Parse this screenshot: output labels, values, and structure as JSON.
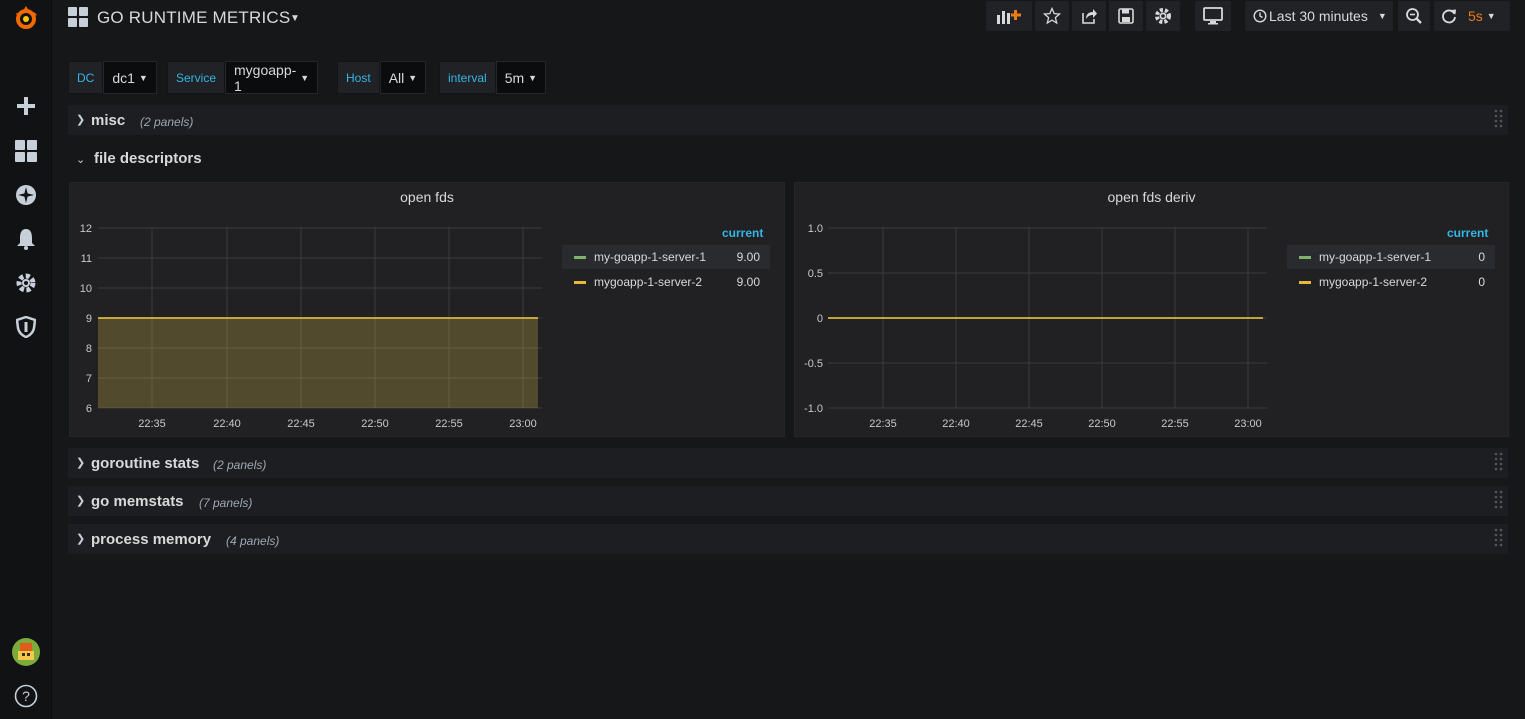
{
  "dashboard": {
    "title": "GO RUNTIME METRICS"
  },
  "toolbar": {
    "time_range": "Last 30 minutes",
    "refresh": "5s"
  },
  "variables": [
    {
      "label": "DC",
      "value": "dc1"
    },
    {
      "label": "Service",
      "value": "mygoapp-1"
    },
    {
      "label": "Host",
      "value": "All"
    },
    {
      "label": "interval",
      "value": "5m"
    }
  ],
  "rows": [
    {
      "title": "misc",
      "count": "(2 panels)",
      "collapsed": true
    },
    {
      "title": "file descriptors",
      "count": "",
      "collapsed": false
    },
    {
      "title": "goroutine stats",
      "count": "(2 panels)",
      "collapsed": true
    },
    {
      "title": "go memstats",
      "count": "(7 panels)",
      "collapsed": true
    },
    {
      "title": "process memory",
      "count": "(4 panels)",
      "collapsed": true
    }
  ],
  "colors": {
    "accent": "#33b5e5",
    "series1": "#7eb26d",
    "series2": "#eab839",
    "refresh": "#eb7b18"
  },
  "chart_data": [
    {
      "type": "area",
      "title": "open fds",
      "x": [
        "22:35",
        "22:40",
        "22:45",
        "22:50",
        "22:55",
        "23:00"
      ],
      "y_ticks": [
        "12",
        "11",
        "10",
        "9",
        "8",
        "7",
        "6"
      ],
      "ylim": [
        6,
        12
      ],
      "series": [
        {
          "name": "my-goapp-1-server-1",
          "values": [
            9,
            9,
            9,
            9,
            9,
            9
          ],
          "current": "9.00",
          "color": "#7eb26d"
        },
        {
          "name": "mygoapp-1-server-2",
          "values": [
            9,
            9,
            9,
            9,
            9,
            9
          ],
          "current": "9.00",
          "color": "#eab839"
        }
      ],
      "legend_header": "current",
      "legend": "right",
      "grid": true
    },
    {
      "type": "line",
      "title": "open fds deriv",
      "x": [
        "22:35",
        "22:40",
        "22:45",
        "22:50",
        "22:55",
        "23:00"
      ],
      "y_ticks": [
        "1.0",
        "0.5",
        "0",
        "-0.5",
        "-1.0"
      ],
      "ylim": [
        -1,
        1
      ],
      "series": [
        {
          "name": "my-goapp-1-server-1",
          "values": [
            0,
            0,
            0,
            0,
            0,
            0
          ],
          "current": "0",
          "color": "#7eb26d"
        },
        {
          "name": "mygoapp-1-server-2",
          "values": [
            0,
            0,
            0,
            0,
            0,
            0
          ],
          "current": "0",
          "color": "#eab839"
        }
      ],
      "legend_header": "current",
      "legend": "right",
      "grid": true
    }
  ]
}
